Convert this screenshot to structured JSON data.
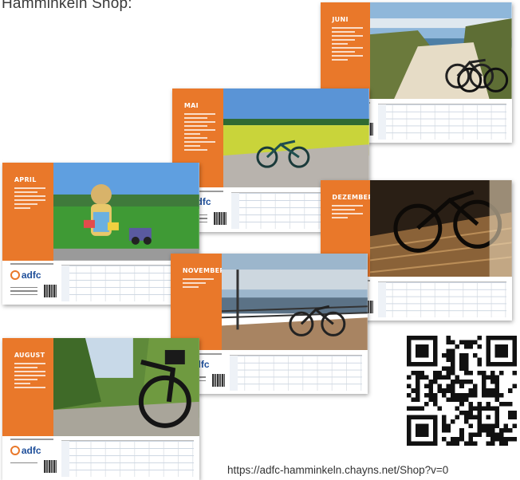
{
  "header": {
    "text": "Hamminkeln Shop:"
  },
  "calendars": [
    {
      "month": "JUNI",
      "scene": "beach"
    },
    {
      "month": "MAI",
      "scene": "field"
    },
    {
      "month": "APRIL",
      "scene": "strawman"
    },
    {
      "month": "DEZEMBER",
      "scene": "shadow"
    },
    {
      "month": "NOVEMBER",
      "scene": "promenade"
    },
    {
      "month": "AUGUST",
      "scene": "forest"
    }
  ],
  "brand": {
    "logo_text": "adfc",
    "accent": "#e9782a",
    "logo_blue": "#1f4f9a"
  },
  "qr": {
    "caption": "https://adfc-hamminkeln.chayns.net/Shop?v=0"
  }
}
